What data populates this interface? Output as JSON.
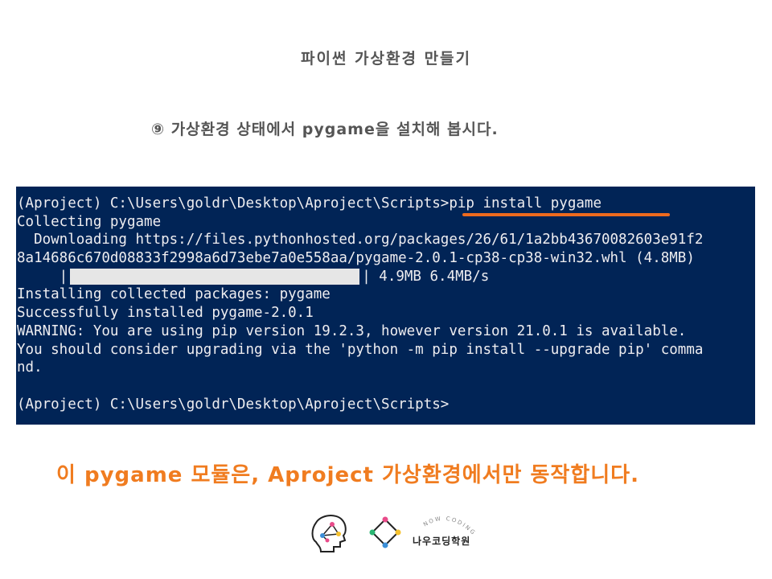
{
  "slide": {
    "title": "파이썬 가상환경 만들기",
    "step": "⑨ 가상환경 상태에서 pygame을 설치해 봅시다.",
    "note": "이 pygame 모듈은, Aproject 가상환경에서만 동작합니다."
  },
  "terminal": {
    "background": "#012456",
    "lines": [
      "(Aproject) C:\\Users\\goldr\\Desktop\\Aproject\\Scripts>pip install pygame",
      "Collecting pygame",
      "  Downloading https://files.pythonhosted.org/packages/26/61/1a2bb43670082603e91f2",
      "8a14686c670d08833f2998a6d73ebe7a0e558aa/pygame-2.0.1-cp38-cp38-win32.whl (4.8MB)"
    ],
    "progress_prefix": "     |",
    "progress_fraction": 1.0,
    "progress_suffix": "| 4.9MB 6.4MB/s",
    "lines_after": [
      "Installing collected packages: pygame",
      "Successfully installed pygame-2.0.1",
      "WARNING: You are using pip version 19.2.3, however version 21.0.1 is available.",
      "You should consider upgrading via the 'python -m pip install --upgrade pip' comma",
      "nd.",
      "",
      "(Aproject) C:\\Users\\goldr\\Desktop\\Aproject\\Scripts>"
    ]
  },
  "highlight_color": "#ee6a1e",
  "note_color": "#f07c20",
  "logo": {
    "arc_text": "NOW CODING",
    "name": "나우코딩학원",
    "icons": [
      "brain-network-icon",
      "diamond-network-icon"
    ]
  }
}
